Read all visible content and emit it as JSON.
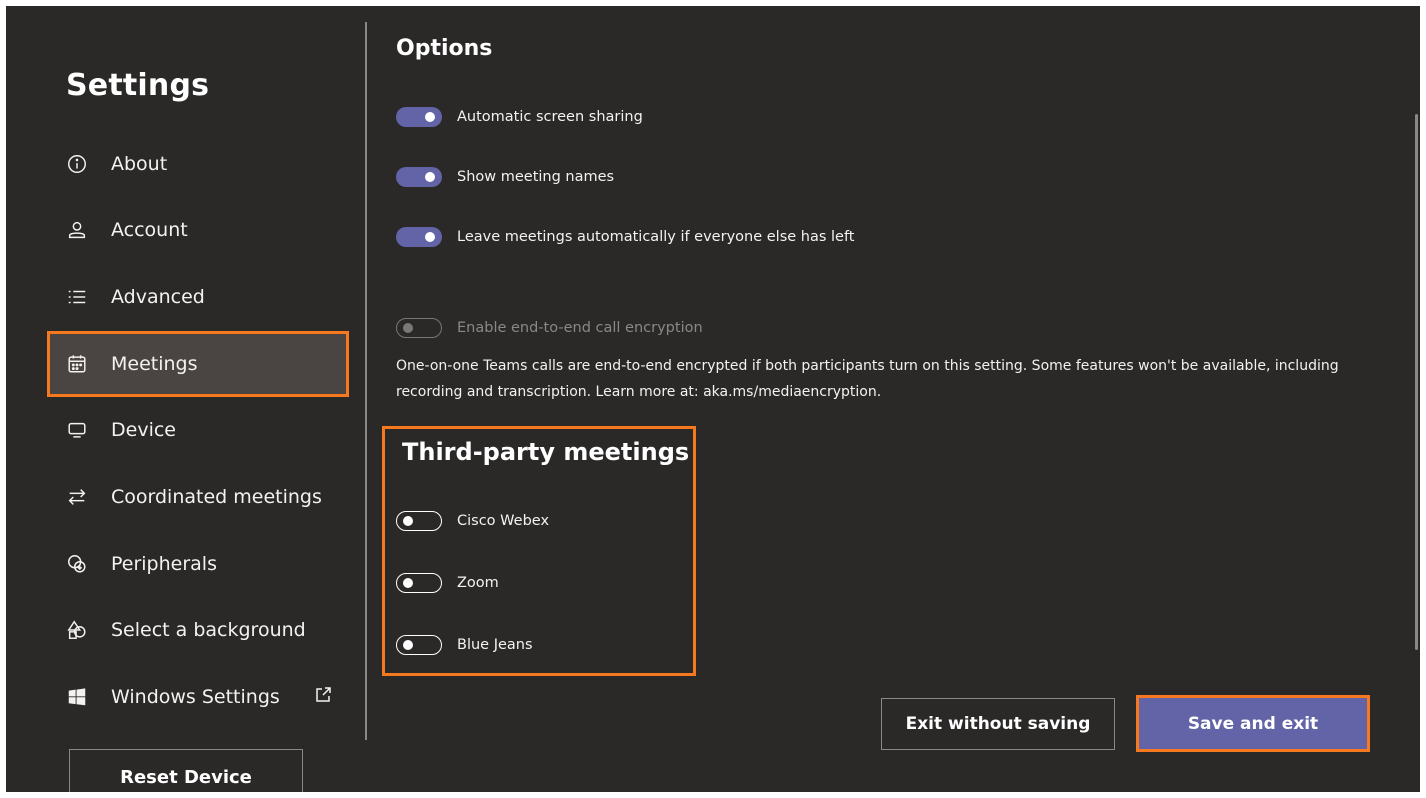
{
  "sidebar": {
    "title": "Settings",
    "items": [
      {
        "label": "About",
        "icon": "info-icon"
      },
      {
        "label": "Account",
        "icon": "person-icon"
      },
      {
        "label": "Advanced",
        "icon": "list-icon"
      },
      {
        "label": "Meetings",
        "icon": "calendar-icon",
        "active": true
      },
      {
        "label": "Device",
        "icon": "monitor-icon"
      },
      {
        "label": "Coordinated meetings",
        "icon": "arrows-swap-icon"
      },
      {
        "label": "Peripherals",
        "icon": "peripherals-icon"
      },
      {
        "label": "Select a background",
        "icon": "shapes-icon"
      },
      {
        "label": "Windows Settings",
        "icon": "windows-logo-icon",
        "external": true
      }
    ],
    "reset_label": "Reset Device"
  },
  "options": {
    "heading": "Options",
    "toggles": [
      {
        "label": "Automatic screen sharing",
        "on": true
      },
      {
        "label": "Show meeting names",
        "on": true
      },
      {
        "label": "Leave meetings automatically if everyone else has left",
        "on": true
      }
    ],
    "encryption": {
      "label": "Enable end-to-end call encryption",
      "on": false,
      "disabled": true,
      "description": "One-on-one Teams calls are end-to-end encrypted if both participants turn on this setting. Some features won't be available, including recording and transcription. Learn more at: aka.ms/mediaencryption."
    }
  },
  "third_party": {
    "heading": "Third-party meetings",
    "toggles": [
      {
        "label": "Cisco Webex",
        "on": false
      },
      {
        "label": "Zoom",
        "on": false
      },
      {
        "label": "Blue Jeans",
        "on": false
      }
    ]
  },
  "footer": {
    "exit_label": "Exit without saving",
    "save_label": "Save and exit"
  },
  "colors": {
    "background": "#2b2928",
    "accent": "#6264a7",
    "highlight": "#f6781f"
  }
}
